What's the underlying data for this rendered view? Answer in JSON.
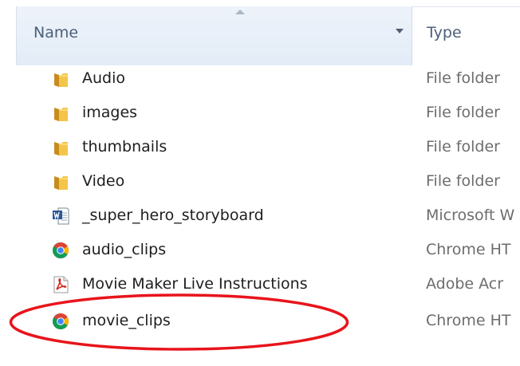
{
  "header": {
    "name_label": "Name",
    "type_label": "Type"
  },
  "files": [
    {
      "name": "Audio",
      "type": "File folder",
      "icon": "folder-icon"
    },
    {
      "name": "images",
      "type": "File folder",
      "icon": "folder-icon"
    },
    {
      "name": "thumbnails",
      "type": "File folder",
      "icon": "folder-icon"
    },
    {
      "name": "Video",
      "type": "File folder",
      "icon": "folder-icon"
    },
    {
      "name": "_super_hero_storyboard",
      "type": "Microsoft W",
      "icon": "word-document-icon"
    },
    {
      "name": "audio_clips",
      "type": "Chrome HT",
      "icon": "chrome-icon"
    },
    {
      "name": "Movie Maker Live Instructions",
      "type": "Adobe Acr",
      "icon": "pdf-icon"
    },
    {
      "name": "movie_clips",
      "type": "Chrome HT",
      "icon": "chrome-icon"
    }
  ],
  "annotation": {
    "highlighted_item": "movie_clips",
    "color": "#e8141b"
  },
  "colors": {
    "header_bg": "#e3ecf7",
    "header_text": "#4c607a",
    "type_text": "#6d6d6d"
  }
}
